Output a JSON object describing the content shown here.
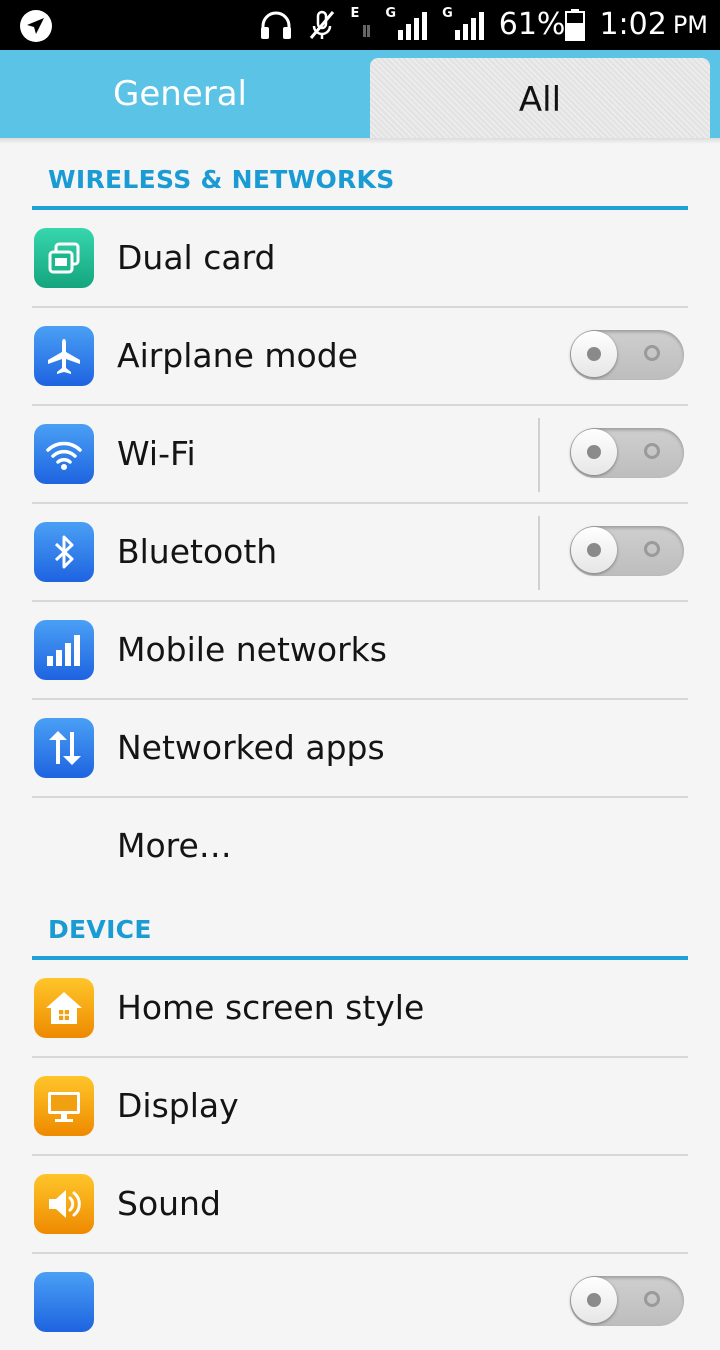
{
  "status_bar": {
    "network_type_1": "E",
    "network_type_2": "G",
    "network_type_3": "G",
    "battery_percent": "61%",
    "time": "1:02",
    "ampm": "PM",
    "icons": [
      "navigation-icon",
      "headset-icon",
      "mute-icon",
      "signal-icon",
      "battery-icon"
    ]
  },
  "tabs": {
    "general": "General",
    "all": "All",
    "active": "all"
  },
  "sections": {
    "wireless_networks": {
      "header": "WIRELESS & NETWORKS",
      "items": [
        {
          "label": "Dual card"
        },
        {
          "label": "Airplane mode",
          "toggle": "off"
        },
        {
          "label": "Wi-Fi",
          "toggle": "off"
        },
        {
          "label": "Bluetooth",
          "toggle": "off"
        },
        {
          "label": "Mobile networks"
        },
        {
          "label": "Networked apps"
        },
        {
          "label": "More…"
        }
      ]
    },
    "device": {
      "header": "DEVICE",
      "items": [
        {
          "label": "Home screen style"
        },
        {
          "label": "Display"
        },
        {
          "label": "Sound"
        }
      ]
    }
  },
  "colors": {
    "tab_bar": "#5bc3e5",
    "section_header_text": "#1a9bd3",
    "section_underline": "#1ea0d8",
    "icon_green": "#14a57e",
    "icon_blue": "#1e63e0",
    "icon_orange": "#ee8a00"
  }
}
